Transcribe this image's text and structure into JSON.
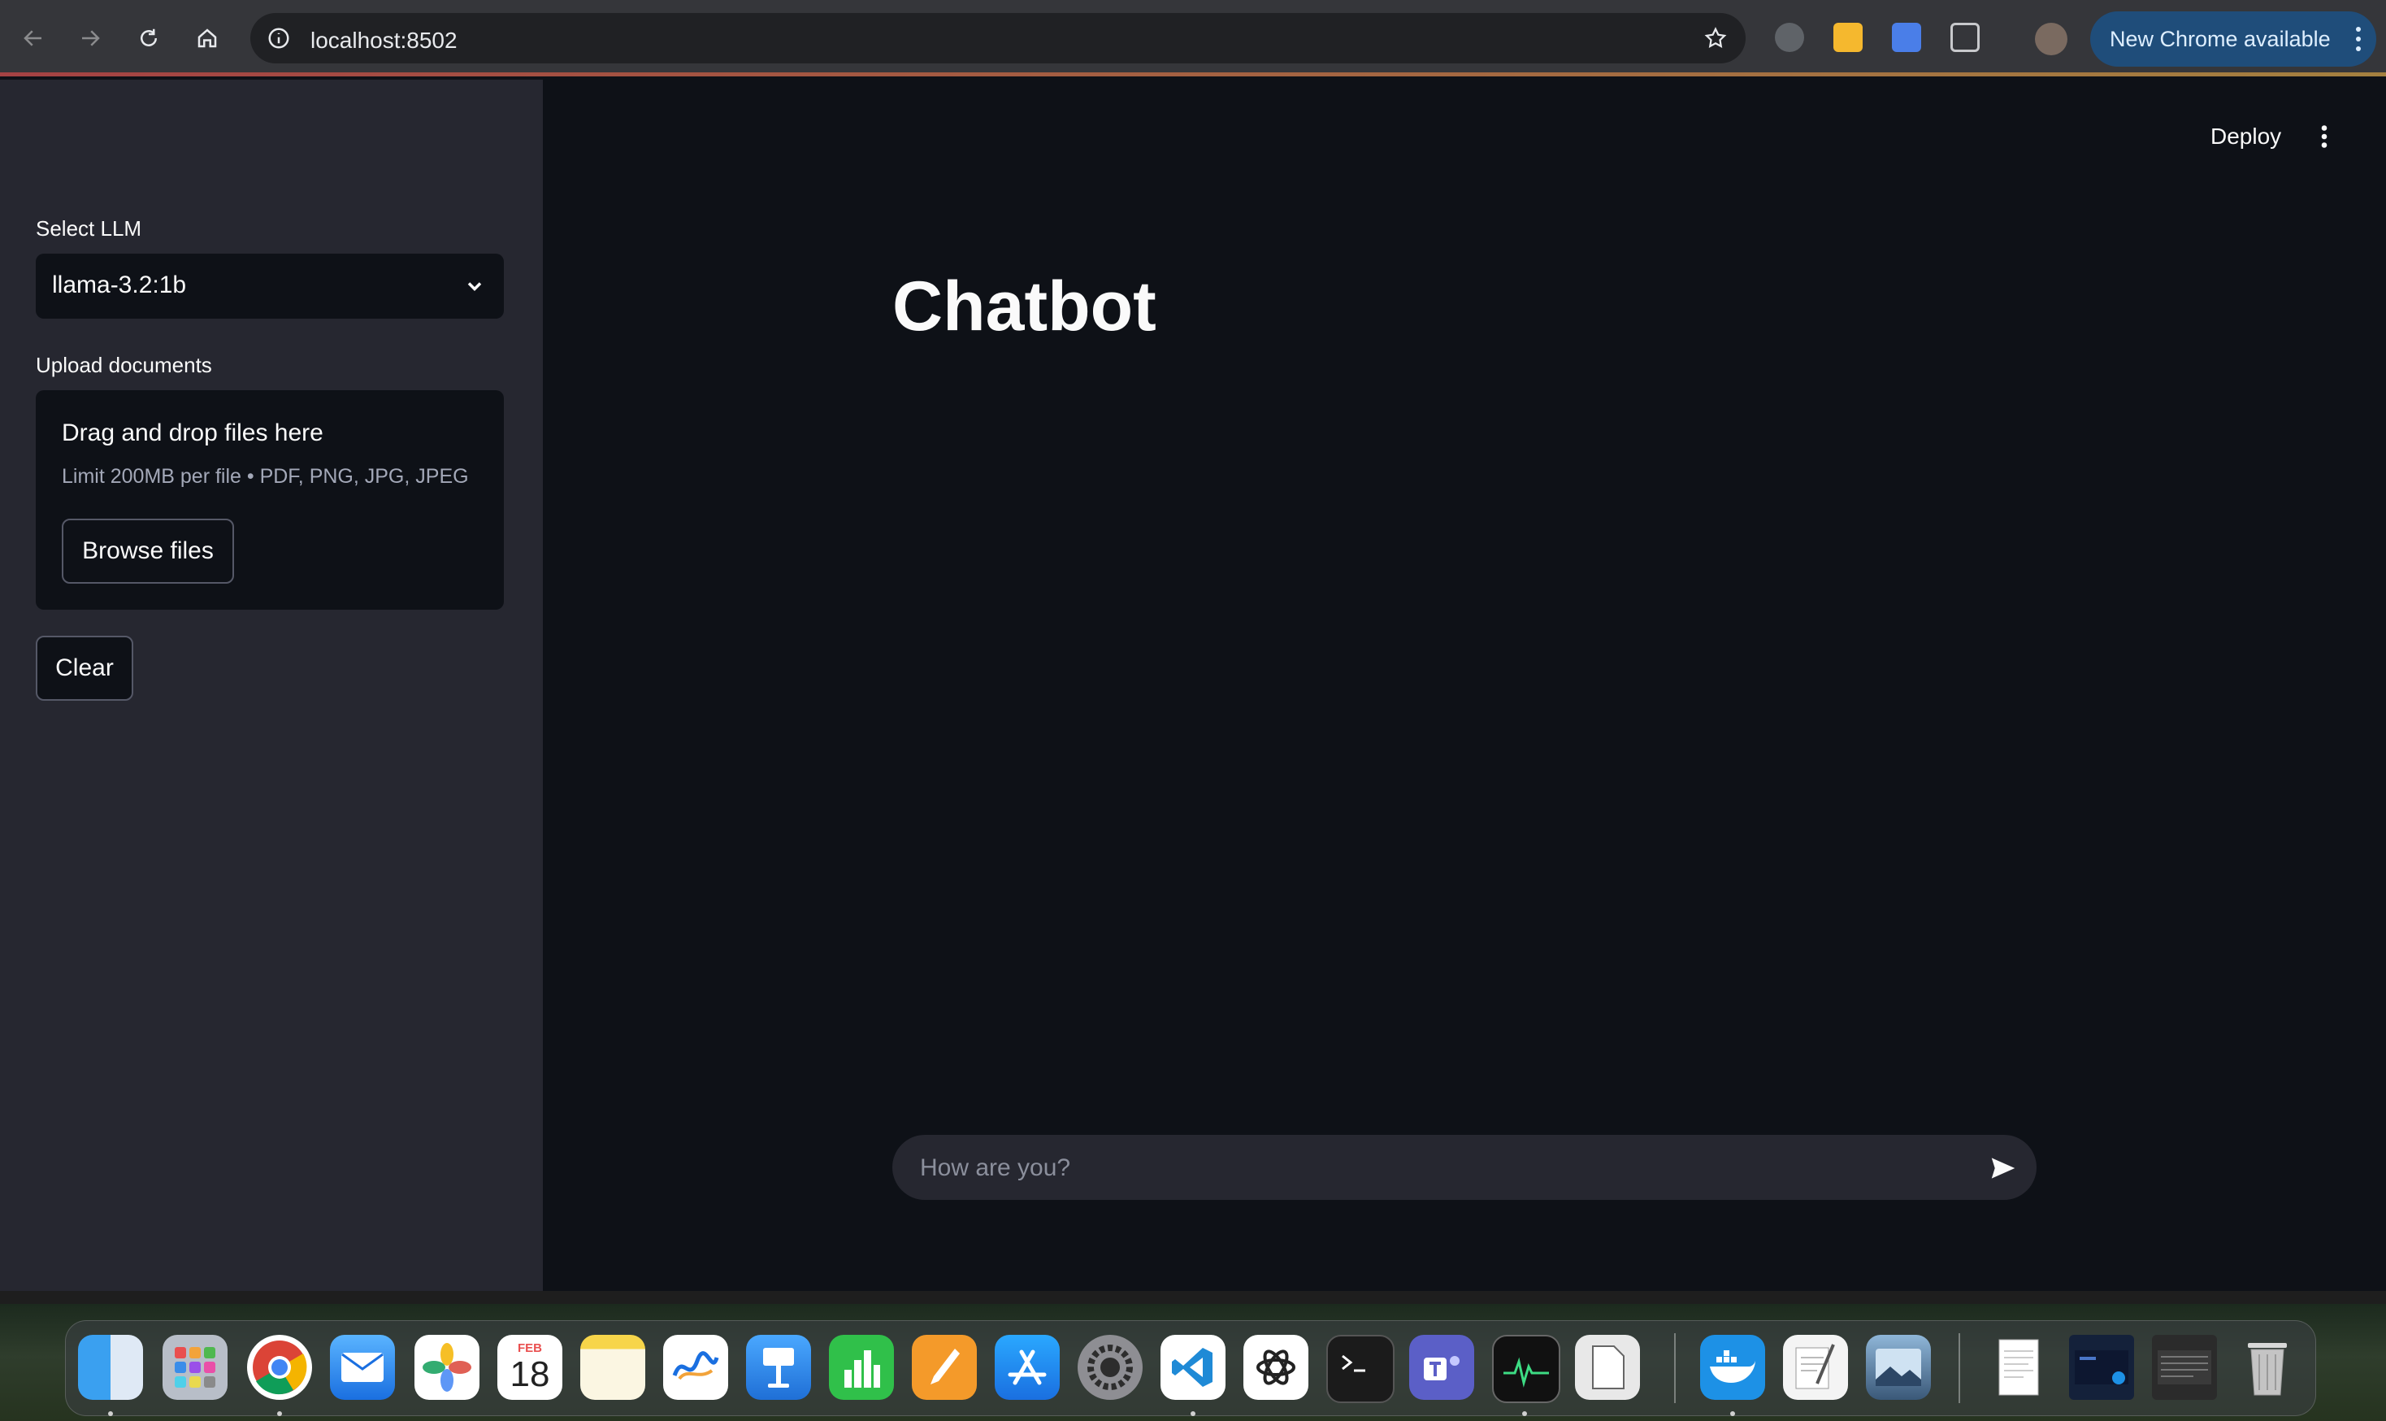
{
  "browser": {
    "url": "localhost:8502",
    "update_label": "New Chrome available"
  },
  "sidebar": {
    "select_label": "Select LLM",
    "selected_model": "llama-3.2:1b",
    "upload_label": "Upload documents",
    "dropzone_title": "Drag and drop files here",
    "dropzone_limit": "Limit 200MB per file • PDF, PNG, JPG, JPEG",
    "browse_button": "Browse files",
    "clear_button": "Clear"
  },
  "header": {
    "deploy_label": "Deploy"
  },
  "main": {
    "title": "Chatbot",
    "chat_placeholder": "How are you?"
  },
  "dock": {
    "calendar_month": "FEB",
    "calendar_day": "18",
    "apps": [
      "finder",
      "launchpad",
      "chrome",
      "mail",
      "photos",
      "calendar",
      "notes",
      "freeform",
      "keynote",
      "numbers",
      "pages",
      "app-store",
      "system-settings",
      "vscode",
      "chatgpt",
      "terminal",
      "teams",
      "activity-monitor",
      "preview",
      "docker",
      "textedit",
      "preview-image",
      "document",
      "screen-window",
      "window-thumbnail",
      "trash"
    ]
  },
  "colors": {
    "app_bg": "#0e1117",
    "sidebar_bg": "#262730",
    "text": "#fafafa",
    "chrome_bg": "#35363a",
    "update_chip": "#1f4d7a"
  }
}
